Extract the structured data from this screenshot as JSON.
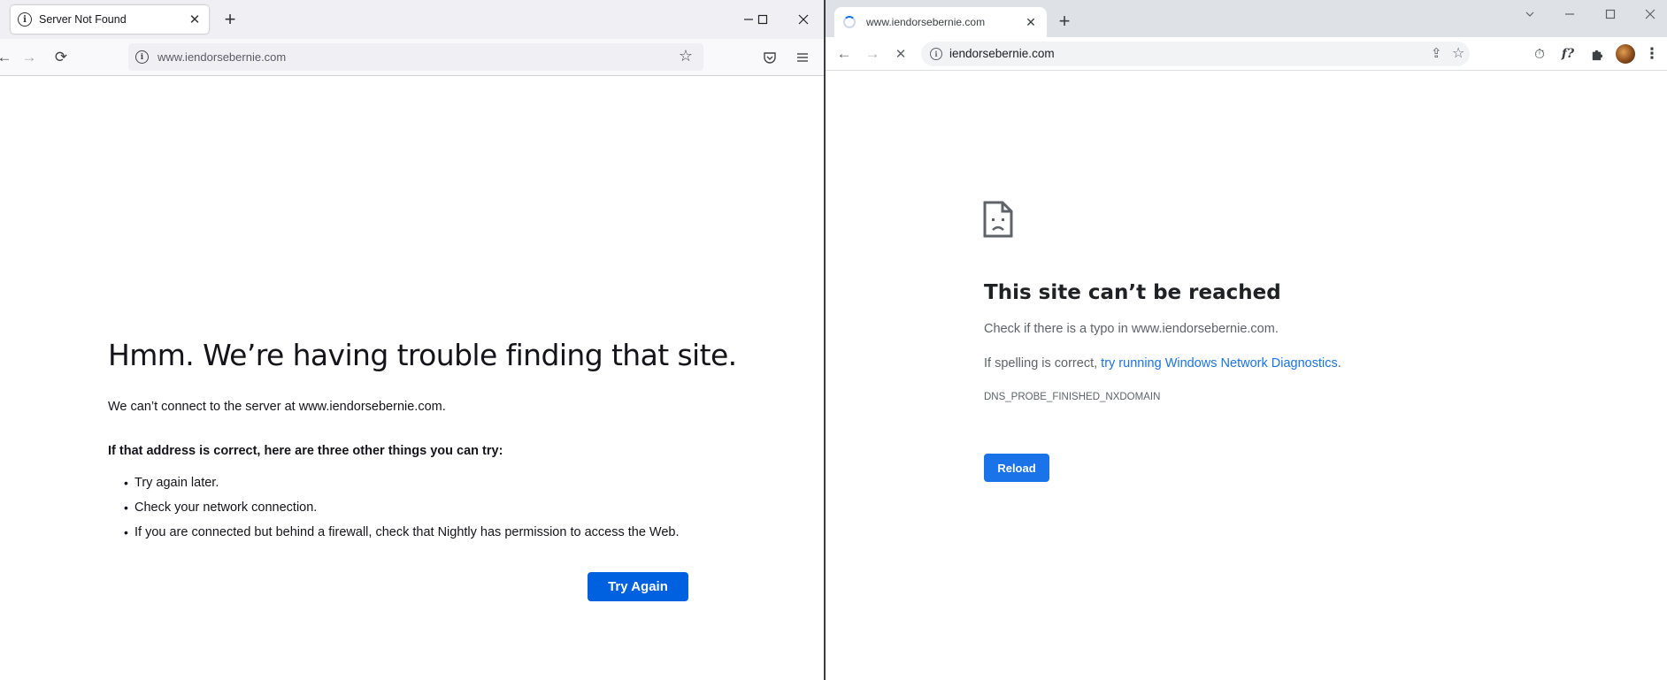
{
  "firefox": {
    "tab_title": "Server Not Found",
    "new_tab_symbol": "+",
    "tab_close_symbol": "✕",
    "window_controls": {
      "minimize": "—",
      "maximize": "☐",
      "close": "✕"
    },
    "nav": {
      "back": "←",
      "forward": "→",
      "reload": "⟳"
    },
    "url": "www.iendorsebernie.com",
    "icons": [
      "info-icon",
      "bookmark-star-icon",
      "pocket-icon",
      "hamburger-menu-icon"
    ],
    "error": {
      "heading": "Hmm. We’re having trouble finding that site.",
      "description": "We can’t connect to the server at www.iendorsebernie.com.",
      "subheading": "If that address is correct, here are three other things you can try:",
      "suggestions": [
        "Try again later.",
        "Check your network connection.",
        "If you are connected but behind a firewall, check that Nightly has permission to access the Web."
      ],
      "bullet": "•",
      "button_label": "Try Again"
    },
    "colors": {
      "button": "#0061e0",
      "tabbar": "#f0f0f4"
    }
  },
  "chrome": {
    "tab_title": "www.iendorsebernie.com",
    "new_tab_symbol": "+",
    "tab_close_symbol": "✕",
    "window_controls": {
      "tab_search": "⌄",
      "minimize": "—",
      "maximize": "☐",
      "close": "✕"
    },
    "nav": {
      "back": "←",
      "forward": "→",
      "stop": "✕"
    },
    "url": "iendorsebernie.com",
    "toolbar_icons": {
      "share": "⇪",
      "star": "☆",
      "timer": "⏱",
      "fx": "f?",
      "puzzle": "✦",
      "menu": "⋮"
    },
    "error": {
      "heading": "This site can’t be reached",
      "line1": "Check if there is a typo in www.iendorsebernie.com.",
      "line2_prefix": "If spelling is correct, ",
      "line2_link": "try running Windows Network Diagnostics",
      "line2_suffix": ".",
      "code": "DNS_PROBE_FINISHED_NXDOMAIN",
      "button_label": "Reload"
    },
    "colors": {
      "button": "#1a73e8",
      "link": "#1a73e8",
      "tabbar": "#dee1e6"
    }
  }
}
